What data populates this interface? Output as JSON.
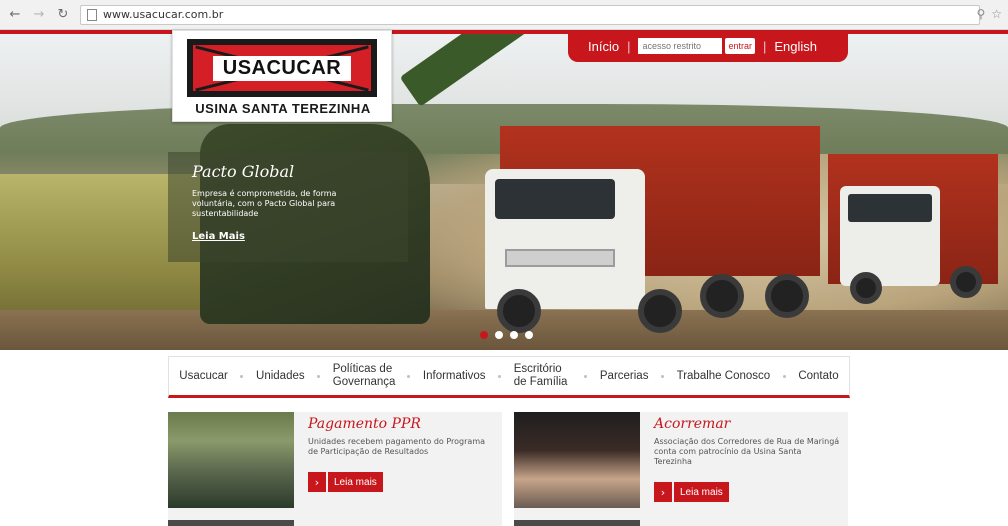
{
  "browser": {
    "url": "www.usacucar.com.br"
  },
  "logo": {
    "name": "USACUCAR",
    "subtitle": "USINA SANTA TEREZINHA"
  },
  "topbar": {
    "home": "Início",
    "access_placeholder": "acesso restrito",
    "enter": "entrar",
    "language": "English"
  },
  "slide": {
    "title": "Pacto Global",
    "text": "Empresa é comprometida, de forma voluntária, com o Pacto Global para sustentabilidade",
    "link": "Leia Mais",
    "dots_total": 4,
    "dot_active": 1
  },
  "nav": {
    "items": [
      {
        "label": "Usacucar"
      },
      {
        "label": "Unidades"
      },
      {
        "label": "Políticas de Governança"
      },
      {
        "label": "Informativos"
      },
      {
        "label": "Escritório de Família"
      },
      {
        "label": "Parcerias"
      },
      {
        "label": "Trabalhe Conosco"
      },
      {
        "label": "Contato"
      }
    ]
  },
  "news": [
    {
      "title": "Pagamento PPR",
      "text": "Unidades recebem pagamento do Programa de Participação de Resultados",
      "button": "Leia mais"
    },
    {
      "title": "Acorremar",
      "text": "Associação dos Corredores de Rua de Maringá conta com patrocínio da Usina Santa Terezinha",
      "button": "Leia mais"
    }
  ],
  "colors": {
    "brand_red": "#c8161d"
  }
}
